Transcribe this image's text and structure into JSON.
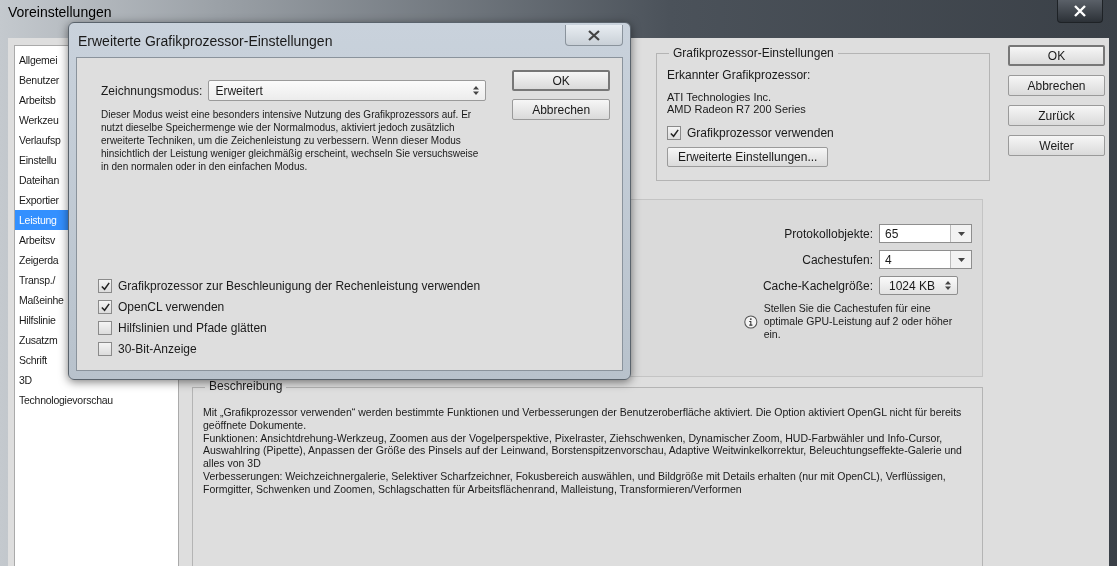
{
  "window": {
    "title": "Voreinstellungen"
  },
  "sidebar": {
    "items": [
      {
        "label": "Allgemei",
        "selected": false
      },
      {
        "label": "Benutzer",
        "selected": false
      },
      {
        "label": "Arbeitsb",
        "selected": false
      },
      {
        "label": "Werkzeu",
        "selected": false
      },
      {
        "label": "Verlaufsp",
        "selected": false
      },
      {
        "label": "Einstellu",
        "selected": false
      },
      {
        "label": "Dateihan",
        "selected": false
      },
      {
        "label": "Exportier",
        "selected": false
      },
      {
        "label": "Leistung",
        "selected": true
      },
      {
        "label": "Arbeitsv",
        "selected": false
      },
      {
        "label": "Zeigerda",
        "selected": false
      },
      {
        "label": "Transp./",
        "selected": false
      },
      {
        "label": "Maßeinhe",
        "selected": false
      },
      {
        "label": "Hilfslinie",
        "selected": false
      },
      {
        "label": "Zusatzm",
        "selected": false
      },
      {
        "label": "Schrift",
        "selected": false
      },
      {
        "label": "3D",
        "selected": false
      },
      {
        "label": "Technologievorschau",
        "selected": false
      }
    ]
  },
  "gpu_group": {
    "title": "Grafikprozessor-Einstellungen",
    "detected_label": "Erkannter Grafikprozessor:",
    "gpu_lines": [
      "ATI Technologies Inc.",
      "AMD Radeon R7 200 Series"
    ],
    "use_gpu": {
      "label": "Grafikprozessor verwenden",
      "checked": true
    },
    "advanced_button": "Erweiterte Einstellungen..."
  },
  "buttons": [
    {
      "label": "OK",
      "default": true
    },
    {
      "label": "Abbrechen",
      "default": false
    },
    {
      "label": "Zurück",
      "default": false
    },
    {
      "label": "Weiter",
      "default": false
    }
  ],
  "performance": {
    "fields": [
      {
        "label": "Protokollobjekte:",
        "value": "65",
        "kind": "combo"
      },
      {
        "label": "Cachestufen:",
        "value": "4",
        "kind": "combo"
      },
      {
        "label": "Cache-Kachelgröße:",
        "value": "1024 KB",
        "kind": "select"
      }
    ],
    "info": "Stellen Sie die Cachestufen für eine optimale GPU-Leistung auf 2 oder höher ein."
  },
  "description": {
    "title": "Beschreibung",
    "paragraphs": [
      "Mit „Grafikprozessor verwenden“ werden bestimmte Funktionen und Verbesserungen der Benutzeroberfläche aktiviert. Die Option aktiviert OpenGL nicht für bereits geöffnete Dokumente.",
      "Funktionen: Ansichtdrehung-Werkzeug, Zoomen aus der Vogelperspektive, Pixelraster, Ziehschwenken, Dynamischer Zoom, HUD-Farbwähler und Info-Cursor, Auswahlring (Pipette), Anpassen der Größe des Pinsels auf der Leinwand, Borstenspitzenvorschau, Adaptive Weitwinkelkorrektur, Beleuchtungseffekte-Galerie und alles von 3D",
      "Verbesserungen: Weichzeichnergalerie, Selektiver Scharfzeichner, Fokusbereich auswählen, und Bildgröße mit Details erhalten (nur mit OpenCL), Verflüssigen, Formgitter, Schwenken und Zoomen, Schlagschatten für Arbeitsflächenrand, Malleistung, Transformieren/Verformen"
    ]
  },
  "dialog": {
    "title": "Erweiterte Grafikprozessor-Einstellungen",
    "mode_label": "Zeichnungsmodus:",
    "mode_value": "Erweitert",
    "mode_text": "Dieser Modus weist eine besonders intensive Nutzung des Grafikprozessors auf. Er nutzt dieselbe Speichermenge wie der Normalmodus, aktiviert jedoch zusätzlich erweiterte Techniken, um die Zeichenleistung zu verbessern. Wenn dieser Modus hinsichtlich der Leistung weniger gleichmäßig erscheint, wechseln Sie versuchsweise in den normalen oder in den einfachen Modus.",
    "buttons": [
      {
        "label": "OK",
        "default": true
      },
      {
        "label": "Abbrechen",
        "default": false
      }
    ],
    "options": [
      {
        "label": "Grafikprozessor zur Beschleunigung der Rechenleistung verwenden",
        "checked": true
      },
      {
        "label": "OpenCL verwenden",
        "checked": true
      },
      {
        "label": "Hilfslinien und Pfade glätten",
        "checked": false
      },
      {
        "label": "30-Bit-Anzeige",
        "checked": false
      }
    ]
  }
}
